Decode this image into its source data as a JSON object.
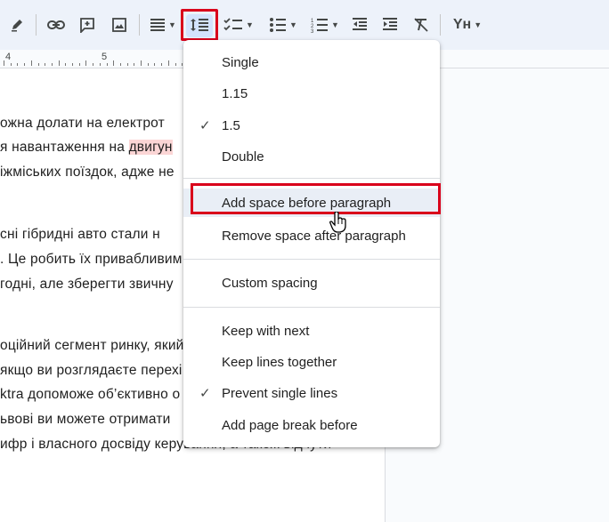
{
  "toolbar": {
    "items": [
      {
        "name": "pen-icon"
      },
      {
        "name": "link-icon"
      },
      {
        "name": "add-comment-icon"
      },
      {
        "name": "insert-image-icon"
      },
      {
        "name": "align-icon"
      },
      {
        "name": "line-spacing-icon"
      },
      {
        "name": "checklist-icon"
      },
      {
        "name": "bulleted-list-icon"
      },
      {
        "name": "numbered-list-icon"
      },
      {
        "name": "decrease-indent-icon"
      },
      {
        "name": "increase-indent-icon"
      },
      {
        "name": "clear-formatting-icon"
      },
      {
        "name": "text-style-icon"
      }
    ],
    "text_style_label": "Yн",
    "highlight_color": "#d9001b"
  },
  "ruler": {
    "labels": [
      "4",
      "5"
    ]
  },
  "document": {
    "lines": [
      {
        "pre": "ожна долати на електрот",
        "hl": "",
        "post": ""
      },
      {
        "pre": "я навантаження на ",
        "hl": "двигун",
        "post": ""
      },
      {
        "pre": "іжміських поїздок, адже не",
        "hl": "",
        "post": ""
      },
      {
        "pre": "сні гібридні авто стали н",
        "hl": "",
        "post": ""
      },
      {
        "pre": ". Це робить їх привабливим",
        "hl": "",
        "post": ""
      },
      {
        "pre": "годні, але зберегти звичну",
        "hl": "",
        "post": ""
      },
      {
        "pre": "оційний сегмент ринку, який",
        "hl": "",
        "post": ""
      },
      {
        "pre": "якщо ви розглядаєте перехі",
        "hl": "",
        "post": ""
      },
      {
        "pre": "ktra допоможе об’єктивно о",
        "hl": "",
        "post": ""
      },
      {
        "pre": "ьвові ви можете отримати",
        "hl": "",
        "post": ""
      },
      {
        "pre": "ифр і власного досвіду керування, а також відчути",
        "hl": "",
        "post": ""
      }
    ]
  },
  "menu": {
    "items": [
      {
        "label": "Single",
        "checked": false
      },
      {
        "label": "1.15",
        "checked": false
      },
      {
        "label": "1.5",
        "checked": true
      },
      {
        "label": "Double",
        "checked": false
      },
      {
        "label": "Add space before paragraph",
        "checked": false,
        "hovered": true
      },
      {
        "label": "Remove space after paragraph",
        "checked": false
      },
      {
        "label": "Custom spacing",
        "checked": false
      },
      {
        "label": "Keep with next",
        "checked": false
      },
      {
        "label": "Keep lines together",
        "checked": false
      },
      {
        "label": "Prevent single lines",
        "checked": true
      },
      {
        "label": "Add page break before",
        "checked": false
      }
    ],
    "check_glyph": "✓"
  }
}
